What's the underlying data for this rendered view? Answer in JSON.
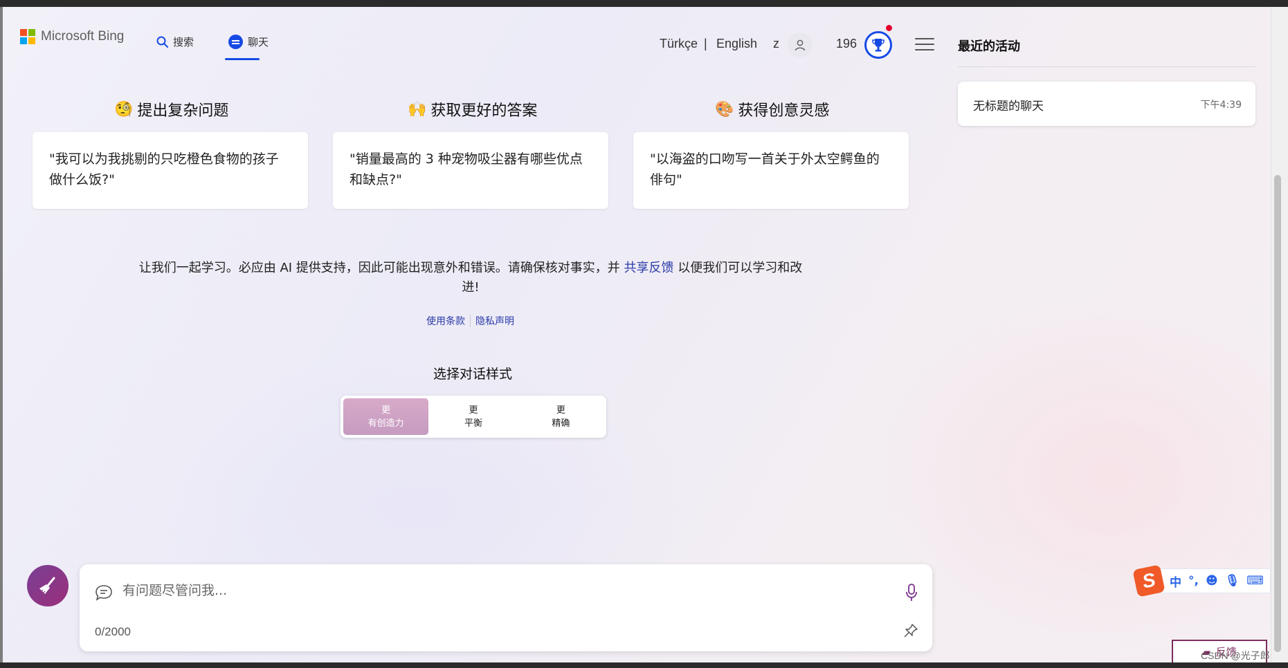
{
  "header": {
    "logo_text": "Microsoft Bing",
    "nav": [
      {
        "label": "搜索",
        "icon": "search-icon"
      },
      {
        "label": "聊天",
        "icon": "chat-icon",
        "active": true
      }
    ],
    "lang_tr": "Türkçe",
    "lang_sep": "|",
    "lang_en": "English",
    "user_initial": "z",
    "points": "196"
  },
  "recent": {
    "title": "最近的活动",
    "items": [
      {
        "name": "无标题的聊天",
        "time": "下午4:39"
      }
    ]
  },
  "features": [
    {
      "emoji": "🧐",
      "title": "提出复杂问题",
      "example": "\"我可以为我挑剔的只吃橙色食物的孩子做什么饭?\""
    },
    {
      "emoji": "🙌",
      "title": "获取更好的答案",
      "example": "\"销量最高的 3 种宠物吸尘器有哪些优点和缺点?\""
    },
    {
      "emoji": "🎨",
      "title": "获得创意灵感",
      "example": "\"以海盗的口吻写一首关于外太空鳄鱼的俳句\""
    }
  ],
  "disclaimer": {
    "before": "让我们一起学习。必应由 AI 提供支持，因此可能出现意外和错误。请确保核对事实，并 ",
    "link": "共享反馈",
    "after": " 以便我们可以学习和改进!"
  },
  "terms": {
    "terms_label": "使用条款",
    "privacy_label": "隐私声明"
  },
  "tone": {
    "title": "选择对话样式",
    "options": [
      {
        "line1": "更",
        "line2": "有创造力",
        "active": true
      },
      {
        "line1": "更",
        "line2": "平衡"
      },
      {
        "line1": "更",
        "line2": "精确"
      }
    ]
  },
  "composer": {
    "placeholder": "有问题尽管问我...",
    "counter": "0/2000"
  },
  "ime": {
    "zh": "中",
    "punct": "°,"
  },
  "feedback_label": "反馈",
  "watermark": "CSDN @光子郎",
  "colors": {
    "accent": "#174ae4",
    "brand_purple": "#7a3f95",
    "link": "#2a3aa8",
    "creative_tone": "#c59bc0"
  }
}
